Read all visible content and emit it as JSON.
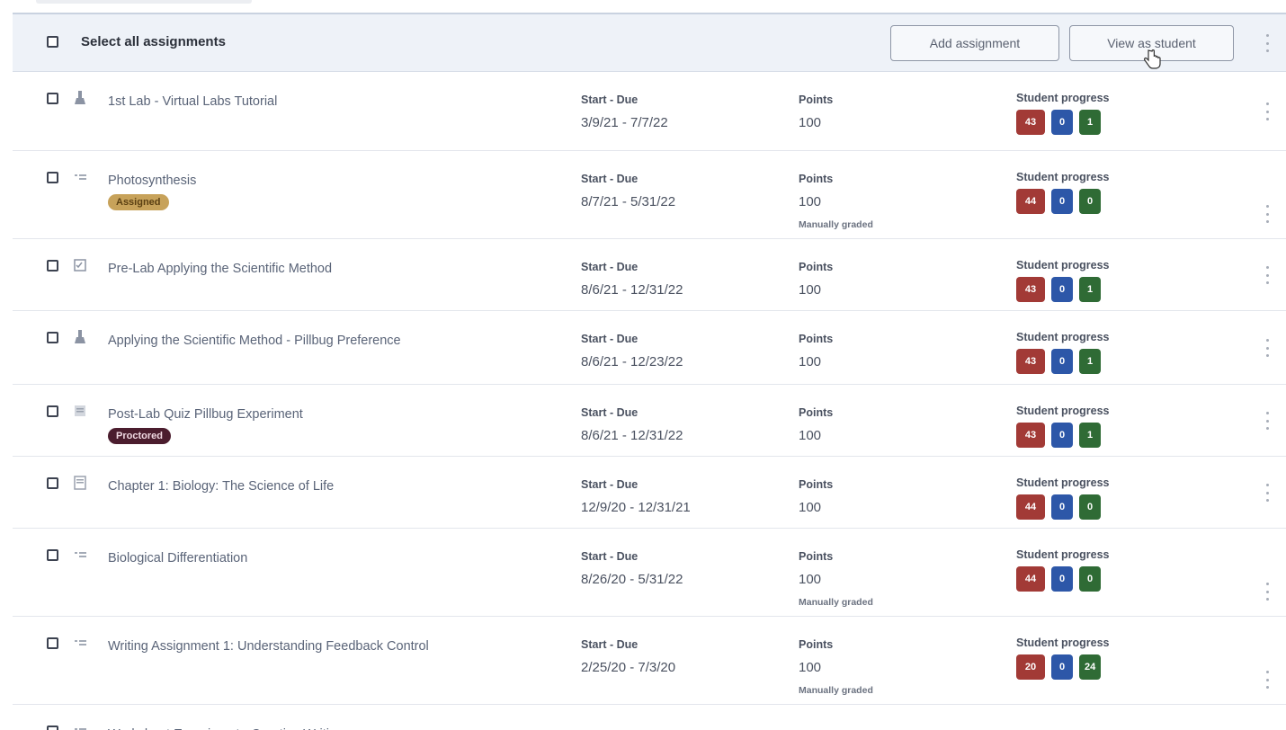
{
  "header": {
    "select_all_label": "Select all assignments",
    "add_assignment_label": "Add assignment",
    "view_as_student_label": "View as student"
  },
  "columns": {
    "dates_label": "Start - Due",
    "points_label": "Points",
    "progress_label": "Student progress"
  },
  "colors": {
    "progress_red": "#a23a36",
    "progress_blue": "#2d57a8",
    "progress_green": "#2f6b35",
    "badge_assigned": "#c7a25a",
    "badge_proctored": "#4b1d2e"
  },
  "rows": [
    {
      "icon": "lab-flask-icon",
      "title": "1st Lab - Virtual Labs Tutorial",
      "dates": "3/9/21 - 7/7/22",
      "points": "100",
      "progress": [
        "43",
        "0",
        "1"
      ]
    },
    {
      "icon": "list-icon",
      "title": "Photosynthesis",
      "badge": "Assigned",
      "dates": "8/7/21 - 5/31/22",
      "points": "100",
      "note": "Manually graded",
      "progress": [
        "44",
        "0",
        "0"
      ]
    },
    {
      "icon": "checklist-icon",
      "title": "Pre-Lab Applying the Scientific Method",
      "dates": "8/6/21 - 12/31/22",
      "points": "100",
      "progress": [
        "43",
        "0",
        "1"
      ]
    },
    {
      "icon": "lab-flask-icon",
      "title": "Applying the Scientific Method - Pillbug Preference",
      "dates": "8/6/21 - 12/23/22",
      "points": "100",
      "progress": [
        "43",
        "0",
        "1"
      ]
    },
    {
      "icon": "quiz-icon",
      "title": "Post-Lab Quiz Pillbug Experiment",
      "badge": "Proctored",
      "dates": "8/6/21 - 12/31/22",
      "points": "100",
      "progress": [
        "43",
        "0",
        "1"
      ]
    },
    {
      "icon": "book-icon",
      "title": "Chapter 1: Biology: The Science of Life",
      "dates": "12/9/20 - 12/31/21",
      "points": "100",
      "progress": [
        "44",
        "0",
        "0"
      ]
    },
    {
      "icon": "list-icon",
      "title": "Biological Differentiation",
      "dates": "8/26/20 - 5/31/22",
      "points": "100",
      "note": "Manually graded",
      "progress": [
        "44",
        "0",
        "0"
      ]
    },
    {
      "icon": "list-icon",
      "title": "Writing Assignment 1: Understanding Feedback Control",
      "dates": "2/25/20 - 7/3/20",
      "points": "100",
      "note": "Manually graded",
      "progress": [
        "20",
        "0",
        "24"
      ]
    },
    {
      "icon": "list-icon",
      "title": "Worksheet Experiment - Creative Writing",
      "dates": "",
      "points": "",
      "progress": []
    }
  ]
}
